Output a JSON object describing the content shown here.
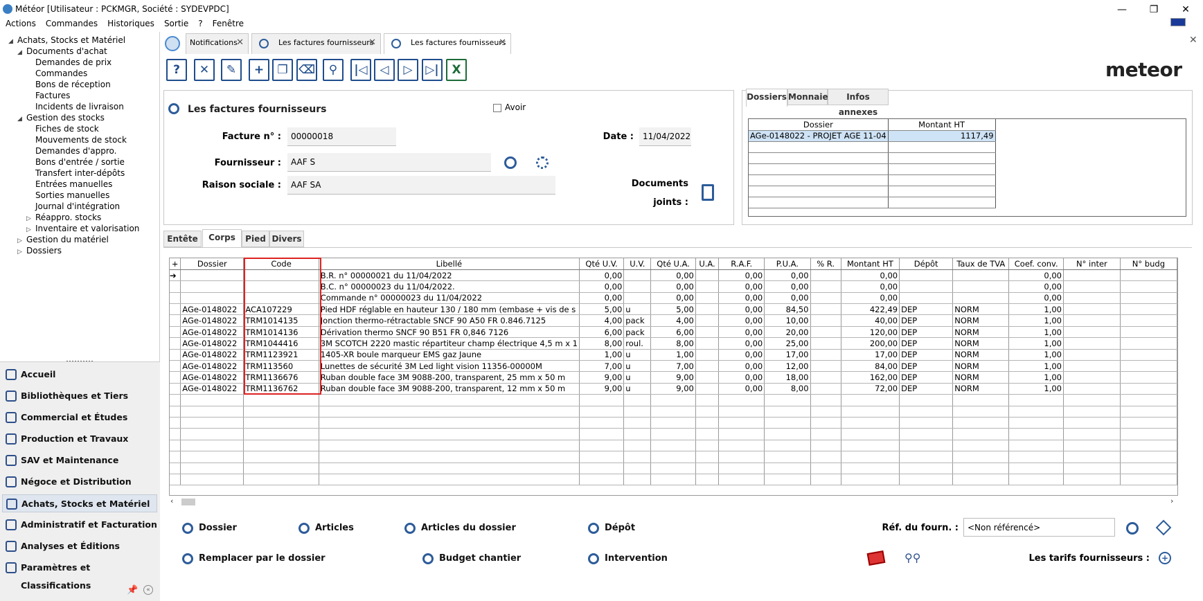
{
  "window": {
    "title": "Météor [Utilisateur : PCKMGR, Société : SYDEVPDC]",
    "minimize": "—",
    "restore": "❐",
    "close": "✕"
  },
  "menu": [
    "Actions",
    "Commandes",
    "Historiques",
    "Sortie",
    "?",
    "Fenêtre"
  ],
  "tree": [
    {
      "label": "Achats, Stocks et Matériel",
      "level": 0,
      "exp": "open"
    },
    {
      "label": "Documents d'achat",
      "level": 1,
      "exp": "open"
    },
    {
      "label": "Demandes de prix",
      "level": 2
    },
    {
      "label": "Commandes",
      "level": 2
    },
    {
      "label": "Bons de réception",
      "level": 2
    },
    {
      "label": "Factures",
      "level": 2
    },
    {
      "label": "Incidents de livraison",
      "level": 2
    },
    {
      "label": "Gestion des stocks",
      "level": 1,
      "exp": "open"
    },
    {
      "label": "Fiches de stock",
      "level": 2
    },
    {
      "label": "Mouvements de stock",
      "level": 2
    },
    {
      "label": "Demandes d'appro.",
      "level": 2
    },
    {
      "label": "Bons d'entrée / sortie",
      "level": 2
    },
    {
      "label": "Transfert inter-dépôts",
      "level": 2
    },
    {
      "label": "Entrées manuelles",
      "level": 2
    },
    {
      "label": "Sorties manuelles",
      "level": 2
    },
    {
      "label": "Journal d'intégration",
      "level": 2
    },
    {
      "label": "Réappro. stocks",
      "level": 2,
      "exp": "closed"
    },
    {
      "label": "Inventaire et valorisation",
      "level": 2,
      "exp": "closed"
    },
    {
      "label": "Gestion du matériel",
      "level": 1,
      "exp": "closed"
    },
    {
      "label": "Dossiers",
      "level": 1,
      "exp": "closed"
    }
  ],
  "modules": [
    "Accueil",
    "Bibliothèques et Tiers",
    "Commercial et Études",
    "Production et Travaux",
    "SAV et Maintenance",
    "Négoce et Distribution",
    "Achats, Stocks et Matériel",
    "Administratif et Facturation",
    "Analyses et Éditions",
    "Paramètres et Classifications"
  ],
  "selected_module": "Achats, Stocks et Matériel",
  "tabs": [
    "Notifications",
    "Les factures fournisseurs",
    "Les factures fournisseurs"
  ],
  "toolbar_icons": [
    "help-icon",
    "cancel-icon",
    "edit-icon",
    "add-icon",
    "copy-icon",
    "delete-icon",
    "search-icon",
    "first-icon",
    "prev-icon",
    "next-icon",
    "last-icon",
    "excel-icon"
  ],
  "toolbar_glyphs": [
    "?",
    "✕",
    "✎",
    "+",
    "❐",
    "⌫",
    "⚲",
    "|◁",
    "◁",
    "▷",
    "▷|",
    "X"
  ],
  "logo": "meteor",
  "form": {
    "title": "Les factures fournisseurs",
    "avoir_label": "Avoir",
    "facture_label": "Facture n° :",
    "facture_value": "00000018",
    "date_label": "Date :",
    "date_value": "11/04/2022",
    "fournisseur_label": "Fournisseur :",
    "fournisseur_value": "AAF S",
    "raison_label": "Raison sociale :",
    "raison_value": "AAF SA",
    "documents_label": "Documents",
    "joints_label": "joints :"
  },
  "right_tabs": [
    "Dossiers",
    "Monnaie",
    "Infos annexes"
  ],
  "dossiers_grid": {
    "headers": [
      "Dossier",
      "Montant HT"
    ],
    "rows": [
      [
        "AGe-0148022 - PROJET AGE 11-04",
        "1117,49"
      ]
    ]
  },
  "sub_tabs": [
    "Entête",
    "Corps",
    "Pied",
    "Divers"
  ],
  "grid": {
    "headers": [
      "+",
      "Dossier",
      "Code",
      "Libellé",
      "Qté U.V.",
      "U.V.",
      "Qté U.A.",
      "U.A.",
      "R.A.F.",
      "P.U.A.",
      "% R.",
      "Montant HT",
      "Dépôt",
      "Taux de TVA",
      "Coef. conv.",
      "N° inter",
      "N° budg"
    ],
    "rows": [
      [
        "➔",
        "",
        "",
        "B.R. n° 00000021 du 11/04/2022",
        "0,00",
        "",
        "0,00",
        "",
        "0,00",
        "0,00",
        "",
        "0,00",
        "",
        "",
        "0,00",
        "",
        ""
      ],
      [
        "",
        "",
        "",
        "B.C. n° 00000023 du 11/04/2022.",
        "0,00",
        "",
        "0,00",
        "",
        "0,00",
        "0,00",
        "",
        "0,00",
        "",
        "",
        "0,00",
        "",
        ""
      ],
      [
        "",
        "",
        "",
        "Commande n° 00000023 du 11/04/2022",
        "0,00",
        "",
        "0,00",
        "",
        "0,00",
        "0,00",
        "",
        "0,00",
        "",
        "",
        "0,00",
        "",
        ""
      ],
      [
        "",
        "AGe-0148022",
        "ACA107229",
        "Pied HDF réglable en hauteur 130 / 180 mm (embase + vis de s",
        "5,00",
        "u",
        "5,00",
        "",
        "0,00",
        "84,50",
        "",
        "422,49",
        "DEP",
        "NORM",
        "1,00",
        "",
        ""
      ],
      [
        "",
        "AGe-0148022",
        "TRM1014135",
        "Jonction thermo-rétractable SNCF 90 A50 FR 0.846.7125",
        "4,00",
        "pack",
        "4,00",
        "",
        "0,00",
        "10,00",
        "",
        "40,00",
        "DEP",
        "NORM",
        "1,00",
        "",
        ""
      ],
      [
        "",
        "AGe-0148022",
        "TRM1014136",
        "Dérivation thermo SNCF 90 B51 FR 0,846 7126",
        "6,00",
        "pack",
        "6,00",
        "",
        "0,00",
        "20,00",
        "",
        "120,00",
        "DEP",
        "NORM",
        "1,00",
        "",
        ""
      ],
      [
        "",
        "AGe-0148022",
        "TRM1044416",
        "3M SCOTCH 2220 mastic répartiteur champ électrique 4,5 m x 1",
        "8,00",
        "roul.",
        "8,00",
        "",
        "0,00",
        "25,00",
        "",
        "200,00",
        "DEP",
        "NORM",
        "1,00",
        "",
        ""
      ],
      [
        "",
        "AGe-0148022",
        "TRM1123921",
        "1405-XR boule marqueur EMS gaz Jaune",
        "1,00",
        "u",
        "1,00",
        "",
        "0,00",
        "17,00",
        "",
        "17,00",
        "DEP",
        "NORM",
        "1,00",
        "",
        ""
      ],
      [
        "",
        "AGe-0148022",
        "TRM113560",
        "Lunettes de sécurité 3M Led light vision 11356-00000M",
        "7,00",
        "u",
        "7,00",
        "",
        "0,00",
        "12,00",
        "",
        "84,00",
        "DEP",
        "NORM",
        "1,00",
        "",
        ""
      ],
      [
        "",
        "AGe-0148022",
        "TRM1136676",
        "Ruban double face 3M 9088-200, transparent, 25 mm x 50 m",
        "9,00",
        "u",
        "9,00",
        "",
        "0,00",
        "18,00",
        "",
        "162,00",
        "DEP",
        "NORM",
        "1,00",
        "",
        ""
      ],
      [
        "",
        "AGe-0148022",
        "TRM1136762",
        "Ruban double face 3M 9088-200, transparent, 12 mm x 50 m",
        "9,00",
        "u",
        "9,00",
        "",
        "0,00",
        "8,00",
        "",
        "72,00",
        "DEP",
        "NORM",
        "1,00",
        "",
        ""
      ]
    ]
  },
  "actions": {
    "dossier": "Dossier",
    "articles": "Articles",
    "articles_dossier": "Articles du dossier",
    "depot": "Dépôt",
    "remplacer": "Remplacer par le dossier",
    "budget": "Budget chantier",
    "intervention": "Intervention",
    "ref_label": "Réf. du fourn. :",
    "ref_value": "<Non référencé>",
    "tarifs_label": "Les tarifs fournisseurs :"
  }
}
